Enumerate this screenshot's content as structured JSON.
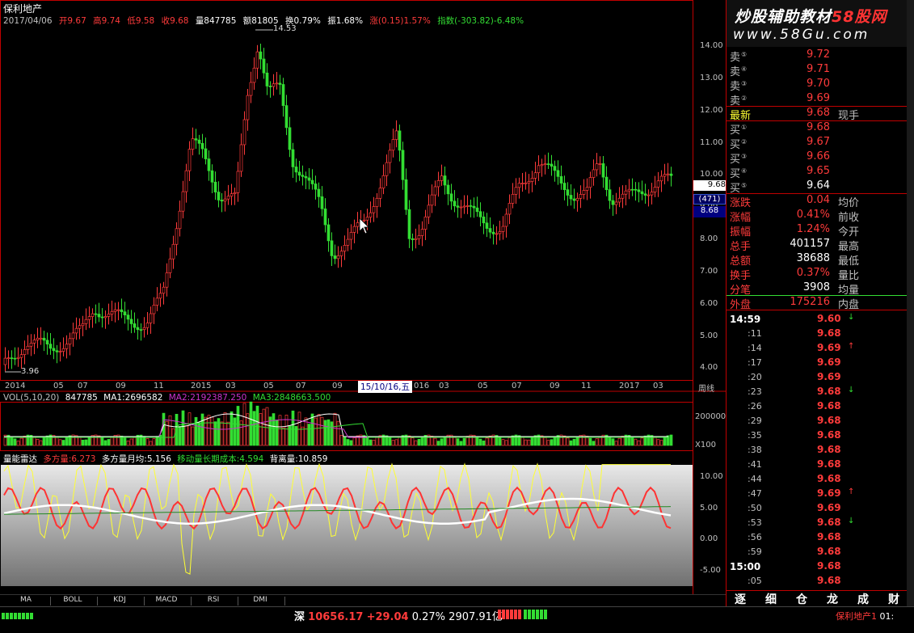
{
  "header": {
    "stock_name": "保利地产",
    "ohlc": {
      "date": "2017/04/06",
      "open": "开9.67",
      "high": "高9.74",
      "low": "低9.58",
      "close": "收9.68",
      "volume": "量847785",
      "amount": "额81805",
      "turnover": "换0.79%",
      "amplitude": "振1.68%",
      "change": "涨(0.15)1.57%",
      "index": "指数(-303.82)-6.48%"
    }
  },
  "price_chart": {
    "max_label": "14.53",
    "min_label": "3.96",
    "price_axis": [
      "14.00",
      "13.00",
      "12.00",
      "11.00",
      "10.00",
      "9.00",
      "8.00",
      "7.00",
      "6.00",
      "5.00",
      "4.00"
    ],
    "current_price_tag": "9.68",
    "ref_tag_1": "(471)",
    "ref_tag_2": "8.68",
    "date_axis": [
      "2014",
      "05",
      "07",
      "09",
      "11",
      "2015",
      "03",
      "05",
      "07",
      "09",
      "2016",
      "03",
      "05",
      "07",
      "09",
      "11",
      "2017",
      "03"
    ],
    "cursor_date": "15/10/16,五",
    "period_button": "周线",
    "cursor_mark": "016"
  },
  "volume_chart": {
    "label": "VOL(5,10,20)",
    "value": "847785",
    "ma1": "MA1:2696582",
    "ma2": "MA2:2192387.250",
    "ma3": "MA3:2848663.500",
    "axis_top": "200000",
    "axis_unit": "X100"
  },
  "indicator_chart": {
    "name": "量能雷达",
    "buy_volume": "多方量:6.273",
    "monthly_avg": "多方量月均:5.156",
    "cost": "移动量长期成本:4.594",
    "back_volume": "背离量:10.859",
    "axis": [
      "10.00",
      "5.00",
      "0.00",
      "-5.00"
    ]
  },
  "bottom_tabs": [
    "MA",
    "BOLL",
    "KDJ",
    "MACD",
    "RSI",
    "DMI"
  ],
  "logo": {
    "line1_a": "炒股辅助教材",
    "line1_b": "58股网",
    "line2": "www.58Gu.com"
  },
  "order_book": {
    "sells": [
      {
        "label": "卖",
        "level": "⑤",
        "price": "9.72"
      },
      {
        "label": "卖",
        "level": "④",
        "price": "9.71"
      },
      {
        "label": "卖",
        "level": "③",
        "price": "9.70"
      },
      {
        "label": "卖",
        "level": "②",
        "price": "9.69"
      }
    ],
    "latest": {
      "label": "最新",
      "price": "9.68",
      "extra": "现手"
    },
    "buys": [
      {
        "label": "买",
        "level": "①",
        "price": "9.68"
      },
      {
        "label": "买",
        "level": "②",
        "price": "9.67"
      },
      {
        "label": "买",
        "level": "③",
        "price": "9.66"
      },
      {
        "label": "买",
        "level": "④",
        "price": "9.65"
      },
      {
        "label": "买",
        "level": "⑤",
        "price": "9.64"
      }
    ]
  },
  "stats": [
    {
      "label": "涨跌",
      "value": "0.04",
      "extra": "均价"
    },
    {
      "label": "涨幅",
      "value": "0.41%",
      "extra": "前收"
    },
    {
      "label": "振幅",
      "value": "1.24%",
      "extra": "今开"
    },
    {
      "label": "总手",
      "value": "401157",
      "extra": "最高"
    },
    {
      "label": "总额",
      "value": "38688",
      "extra": "最低"
    },
    {
      "label": "换手",
      "value": "0.37%",
      "extra": "量比"
    },
    {
      "label": "分笔",
      "value": "3908",
      "extra": "均量"
    }
  ],
  "outer_inner": {
    "label": "外盘",
    "value": "175216",
    "extra": "内盘"
  },
  "ticks": [
    {
      "time": "14:59",
      "price": "9.60",
      "arrow": "↓"
    },
    {
      "time": ":11",
      "price": "9.68",
      "arrow": ""
    },
    {
      "time": ":14",
      "price": "9.69",
      "arrow": "↑"
    },
    {
      "time": ":17",
      "price": "9.69",
      "arrow": ""
    },
    {
      "time": ":20",
      "price": "9.69",
      "arrow": ""
    },
    {
      "time": ":23",
      "price": "9.68",
      "arrow": "↓"
    },
    {
      "time": ":26",
      "price": "9.68",
      "arrow": ""
    },
    {
      "time": ":29",
      "price": "9.68",
      "arrow": ""
    },
    {
      "time": ":35",
      "price": "9.68",
      "arrow": ""
    },
    {
      "time": ":38",
      "price": "9.68",
      "arrow": ""
    },
    {
      "time": ":41",
      "price": "9.68",
      "arrow": ""
    },
    {
      "time": ":44",
      "price": "9.68",
      "arrow": ""
    },
    {
      "time": ":47",
      "price": "9.69",
      "arrow": "↑"
    },
    {
      "time": ":50",
      "price": "9.69",
      "arrow": ""
    },
    {
      "time": ":53",
      "price": "9.68",
      "arrow": "↓"
    },
    {
      "time": ":56",
      "price": "9.68",
      "arrow": ""
    },
    {
      "time": ":59",
      "price": "9.68",
      "arrow": ""
    },
    {
      "time": "15:00",
      "price": "9.68",
      "arrow": ""
    },
    {
      "time": ":05",
      "price": "9.68",
      "arrow": ""
    }
  ],
  "right_tabs": [
    "逐",
    "细",
    "仓",
    "龙",
    "成",
    "财"
  ],
  "status": {
    "market": "深",
    "index_value": "10656.17",
    "index_change": "+29.04",
    "index_pct": "0.27%",
    "amount": "2907.91亿",
    "right_label": "保利地产1",
    "right_time": "01:"
  },
  "colors": {
    "up": "#ff3b3b",
    "down": "#33dd33",
    "accent": "#c00000"
  }
}
